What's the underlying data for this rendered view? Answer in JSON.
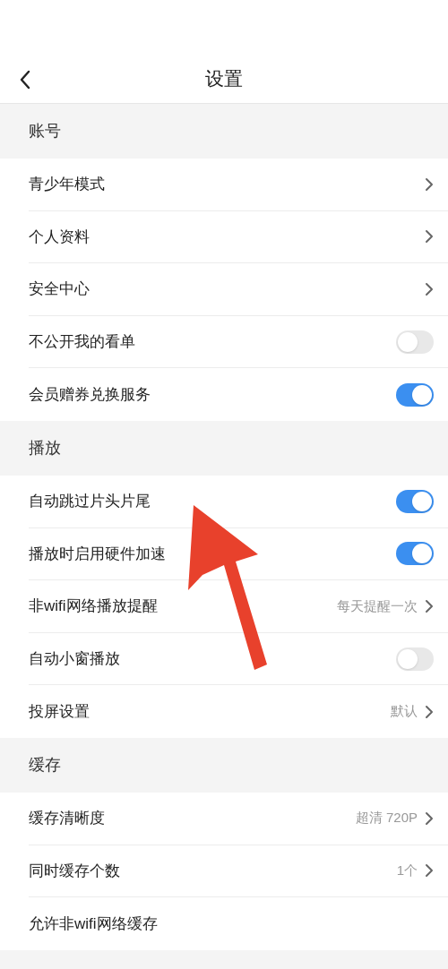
{
  "header": {
    "title": "设置"
  },
  "sections": [
    {
      "title": "账号",
      "rows": [
        {
          "kind": "link",
          "label": "青少年模式"
        },
        {
          "kind": "link",
          "label": "个人资料"
        },
        {
          "kind": "link",
          "label": "安全中心"
        },
        {
          "kind": "toggle",
          "label": "不公开我的看单",
          "on": false
        },
        {
          "kind": "toggle",
          "label": "会员赠券兑换服务",
          "on": true
        }
      ]
    },
    {
      "title": "播放",
      "rows": [
        {
          "kind": "toggle",
          "label": "自动跳过片头片尾",
          "on": true
        },
        {
          "kind": "toggle",
          "label": "播放时启用硬件加速",
          "on": true
        },
        {
          "kind": "link",
          "label": "非wifi网络播放提醒",
          "value": "每天提醒一次"
        },
        {
          "kind": "toggle",
          "label": "自动小窗播放",
          "on": false
        },
        {
          "kind": "link",
          "label": "投屏设置",
          "value": "默认"
        }
      ]
    },
    {
      "title": "缓存",
      "rows": [
        {
          "kind": "link",
          "label": "缓存清晰度",
          "value": "超清 720P"
        },
        {
          "kind": "link",
          "label": "同时缓存个数",
          "value": "1个"
        },
        {
          "kind": "plain",
          "label": "允许非wifi网络缓存"
        }
      ]
    }
  ]
}
